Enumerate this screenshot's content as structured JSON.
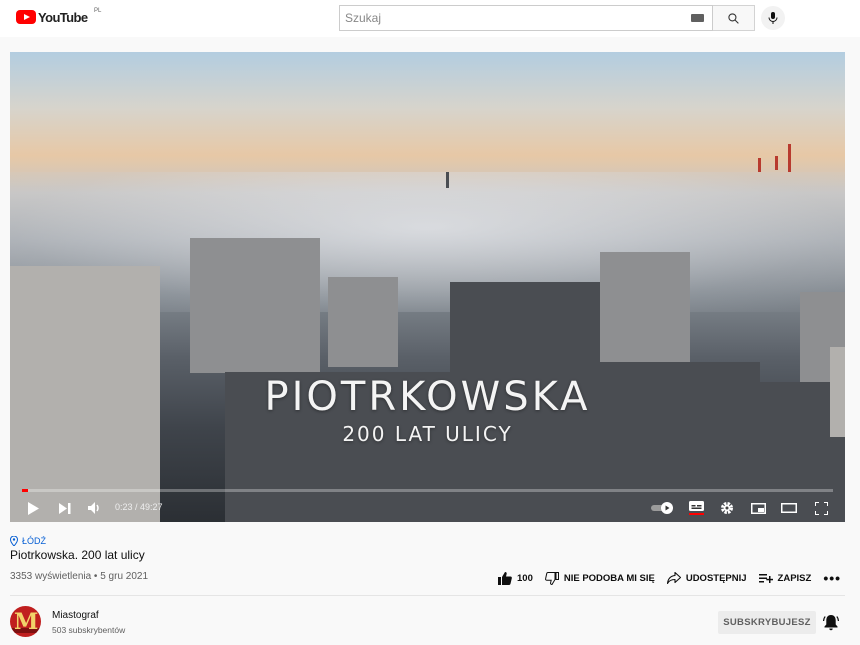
{
  "header": {
    "logo_text": "YouTube",
    "region": "PL",
    "search_placeholder": "Szukaj"
  },
  "player": {
    "overlay_title": "PIOTRKOWSKA",
    "overlay_subtitle": "200 LAT ULICY",
    "time_current": "0:23",
    "time_total": "49:27",
    "time_display": "0:23 / 49:27",
    "progress_fraction": 0.008
  },
  "video": {
    "location": "ŁÓDŹ",
    "title": "Piotrkowska. 200 lat ulicy",
    "meta": "3353 wyświetlenia • 5 gru 2021"
  },
  "actions": {
    "like_count": "100",
    "dislike_label": "NIE PODOBA MI SIĘ",
    "share_label": "UDOSTĘPNIJ",
    "save_label": "ZAPISZ",
    "more_label": "•••"
  },
  "channel": {
    "name": "Miastograf",
    "subscribers": "503 subskrybentów",
    "subscribe_label": "SUBSKRYBUJESZ",
    "avatar_letter": "M"
  },
  "colors": {
    "brand": "#ff0000",
    "link": "#065fd4"
  }
}
